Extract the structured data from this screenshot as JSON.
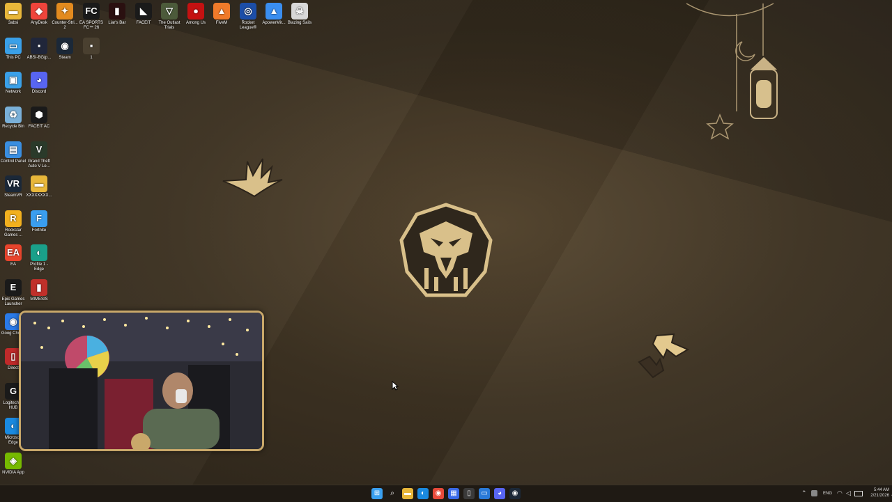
{
  "desktop": {
    "icons": [
      {
        "label": "3absi",
        "icon": "folder-icon",
        "color": "#e8b73a"
      },
      {
        "label": "AnyDesk",
        "icon": "anydesk-icon",
        "color": "#ef443b"
      },
      {
        "label": "Counter-Stri... 2",
        "icon": "counter-strike-icon",
        "color": "#e38a1e"
      },
      {
        "label": "EA SPORTS FC™ 26",
        "icon": "ea-sports-fc-icon",
        "color": "#1a1a1a"
      },
      {
        "label": "Liar's Bar",
        "icon": "liars-bar-icon",
        "color": "#2a1010"
      },
      {
        "label": "FACEIT",
        "icon": "faceit-icon",
        "color": "#1a1a1a"
      },
      {
        "label": "The Outlast Trials",
        "icon": "outlast-trials-icon",
        "color": "#4c5a3a"
      },
      {
        "label": "Among Us",
        "icon": "among-us-icon",
        "color": "#c51111"
      },
      {
        "label": "FiveM",
        "icon": "fivem-icon",
        "color": "#f07a2a"
      },
      {
        "label": "Rocket League®",
        "icon": "rocket-league-icon",
        "color": "#1c4ea8"
      },
      {
        "label": "ApowerMir...",
        "icon": "apowermirror-icon",
        "color": "#3a8ef0"
      },
      {
        "label": "Blazing Sails",
        "icon": "blazing-sails-icon",
        "color": "#d8d8d8"
      },
      {
        "label": "This PC",
        "icon": "this-pc-icon",
        "color": "#3aa0e8"
      },
      {
        "label": "ABSI-BG(p...",
        "icon": "image-file-icon",
        "color": "#20263a"
      },
      {
        "label": "Steam",
        "icon": "steam-icon",
        "color": "#1b2838"
      },
      {
        "label": "1",
        "icon": "image-file-icon",
        "color": "#4a4030"
      },
      {
        "label": "Network",
        "icon": "network-icon",
        "color": "#3aa0e8"
      },
      {
        "label": "Discord",
        "icon": "discord-icon",
        "color": "#5865f2"
      },
      {
        "label": "Recycle Bin",
        "icon": "recycle-bin-icon",
        "color": "#7ab0d8"
      },
      {
        "label": "FACEIT AC",
        "icon": "faceit-ac-icon",
        "color": "#1a1a1a"
      },
      {
        "label": "Control Panel",
        "icon": "control-panel-icon",
        "color": "#3a8ee0"
      },
      {
        "label": "Grand Theft Auto V Le...",
        "icon": "gta-v-icon",
        "color": "#2a3a2a"
      },
      {
        "label": "SteamVR",
        "icon": "steamvr-icon",
        "color": "#1b2838"
      },
      {
        "label": "XXXXXXXX...",
        "icon": "folder-icon",
        "color": "#e8b73a"
      },
      {
        "label": "Rockstar Games ...",
        "icon": "rockstar-icon",
        "color": "#f2b01e"
      },
      {
        "label": "Fortnite",
        "icon": "fortnite-icon",
        "color": "#3a9ef0"
      },
      {
        "label": "EA",
        "icon": "ea-icon",
        "color": "#e8442c"
      },
      {
        "label": "Profile 1 - Edge",
        "icon": "edge-icon",
        "color": "#1aa08a"
      },
      {
        "label": "Epic Games Launcher",
        "icon": "epic-games-icon",
        "color": "#1a1a1a"
      },
      {
        "label": "MIMESIS",
        "icon": "mimesis-icon",
        "color": "#c0302a"
      },
      {
        "label": "Goog Chrom",
        "icon": "chrome-icon",
        "color": "#2a7ae8"
      },
      {
        "label": "Direct",
        "icon": "app-icon",
        "color": "#c02a2a"
      },
      {
        "label": "Logitech G HUB",
        "icon": "logitech-icon",
        "color": "#1a1a1a"
      },
      {
        "label": "Microsoft Edge",
        "icon": "edge-icon",
        "color": "#1a8ae0"
      },
      {
        "label": "NVIDIA App",
        "icon": "nvidia-icon",
        "color": "#76b900"
      }
    ]
  },
  "taskbar": {
    "items": [
      {
        "name": "start-button",
        "icon": "windows-start-icon",
        "color": "#3aa0f0"
      },
      {
        "name": "search-button",
        "icon": "search-icon",
        "color": "transparent"
      },
      {
        "name": "file-explorer-button",
        "icon": "file-explorer-icon",
        "color": "#e8b73a"
      },
      {
        "name": "edge-button",
        "icon": "edge-icon",
        "color": "#1a8ae0"
      },
      {
        "name": "chrome-button",
        "icon": "chrome-icon",
        "color": "#e84a3a"
      },
      {
        "name": "store-button",
        "icon": "store-icon",
        "color": "#3a6ae8"
      },
      {
        "name": "app-button",
        "icon": "app-icon",
        "color": "#3a3a3a"
      },
      {
        "name": "window-button",
        "icon": "window-icon",
        "color": "#2a7ad8"
      },
      {
        "name": "discord-button",
        "icon": "discord-icon",
        "color": "#5865f2"
      },
      {
        "name": "steam-button",
        "icon": "steam-icon",
        "color": "#1b2838"
      }
    ],
    "tray": {
      "language": "ENG",
      "time": "5:44 AM",
      "date": "2/21/2026"
    }
  }
}
